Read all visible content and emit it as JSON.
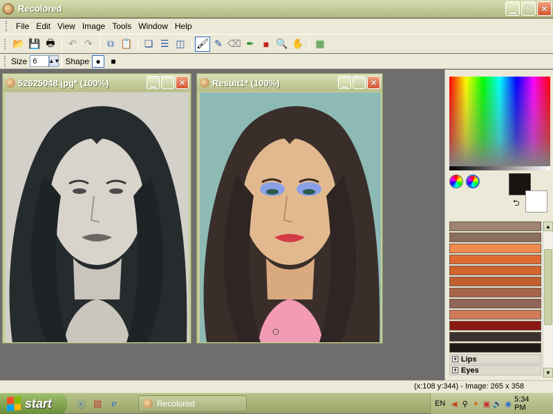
{
  "window": {
    "title": "Recolored"
  },
  "menu": [
    "File",
    "Edit",
    "View",
    "Image",
    "Tools",
    "Window",
    "Help"
  ],
  "toolbar": {
    "buttons": [
      "open-icon",
      "save-icon",
      "print-icon",
      "undo-icon",
      "redo-icon",
      "copy-icon",
      "paste-icon",
      "cascade-icon",
      "tile-horizontal-icon",
      "tile-vertical-icon",
      "brush-icon",
      "pen-icon",
      "eraser-icon",
      "eyedropper-icon",
      "fill-icon",
      "zoom-icon",
      "hand-icon",
      "compare-icon"
    ]
  },
  "options": {
    "size_label": "Size",
    "size_value": "6",
    "shape_label": "Shape"
  },
  "documents": [
    {
      "title": "52625048.jpg* (100%)"
    },
    {
      "title": "Result1* (100%)"
    }
  ],
  "palette": {
    "fg_color": "#1a1410",
    "bg_color": "#ffffff",
    "swatches": [
      "#a08472",
      "#8a6e5e",
      "#f28a4e",
      "#e06a32",
      "#d2642e",
      "#c06030",
      "#a86448",
      "#906458",
      "#d07c58",
      "#8a1a14",
      "#3a3230",
      "#1e1a18"
    ],
    "groups": [
      "Lips",
      "Eyes"
    ]
  },
  "status": {
    "text": "(x:108 y:344) - Image: 265 x 358"
  },
  "taskbar": {
    "start_label": "start",
    "task_label": "Recolored",
    "language": "EN",
    "clock": "5:34 PM"
  }
}
